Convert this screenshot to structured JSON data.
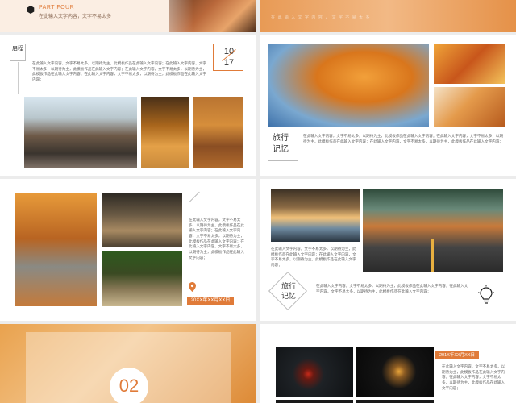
{
  "colors": {
    "accent": "#e07b39",
    "accent_light": "#f0b07c",
    "bg": "#ececec",
    "text": "#666666"
  },
  "slide1": {
    "part": "PART FOUR",
    "subtitle": "在此输入文字内容，文字不易太多",
    "icon": "hexagon-icon"
  },
  "slide2": {
    "faded_text": "在 此 输 入 文 字 内 容 ， 文 字 不 易 太 多"
  },
  "slide3": {
    "title": "启程",
    "date": "10\n17",
    "body": "在此输入文字内容，文字不易太多，以期待为主，此模板作品在此输入文字内容；在此输入文字内容，文字不易太多，以期待为主，此模板作品在此输入文字内容；在此输入文字内容，文字不易太多，以期待为主，此模板作品在此输入文字内容；在此输入文字内容，文字不易太多，以期待为主，此模板作品在此输入文字内容；"
  },
  "slide4": {
    "title": "旅行\n记忆",
    "body": "在此输入文字内容，文字不易太多，以期待为主，此模板作品在此输入文字内容；在此输入文字内容，文字不易太多，以期待为主，此模板作品在此输入文字内容；在此输入文字内容，文字不易太多，以期待为主，此模板作品在此输入文字内容；"
  },
  "slide5": {
    "body": "在此输入文字内容，文字不易太多，以期待为主，此模板作品在此输入文字内容；在此输入文字内容，文字不易太多，以期待为主，此模板作品在此输入文字内容；在此输入文字内容，文字不易太多，以期待为主，此模板作品在此输入文字内容；",
    "date": "20XX年XX月XX日",
    "icon": "location-pin-icon"
  },
  "slide6": {
    "title": "旅行\n记忆",
    "body_top": "在此输入文字内容，文字不易太多，以期待为主，此模板作品在此输入文字内容；在此输入文字内容，文字不易太多，以期待为主，此模板作品在此输入文字内容；",
    "body_bottom": "在此输入文字内容，文字不易太多，以期待为主，此模板作品在此输入文字内容；在此输入文字内容，文字不易太多，以期待为主，此模板作品在此输入文字内容；",
    "icon": "lightbulb-icon"
  },
  "slide7": {
    "number": "02"
  },
  "slide8": {
    "date": "201X年XX月XX日",
    "body": "在此输入文字内容，文字不易太多，以期待为主，此模板作品在此输入文字内容；在此输入文字内容，文字不易太多，以期待为主，此模板作品在此输入文字内容；"
  }
}
